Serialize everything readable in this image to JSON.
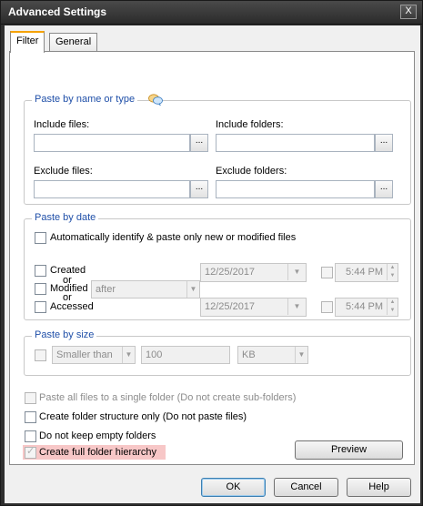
{
  "window": {
    "title": "Advanced Settings",
    "close_glyph": "X"
  },
  "tabs": [
    {
      "label": "Filter",
      "active": true
    },
    {
      "label": "General",
      "active": false
    }
  ],
  "paste_by_name": {
    "title": "Paste by name or type",
    "include_files_label": "Include files:",
    "include_folders_label": "Include folders:",
    "exclude_files_label": "Exclude files:",
    "exclude_folders_label": "Exclude folders:",
    "browse_label": "...",
    "include_files_value": "",
    "include_folders_value": "",
    "exclude_files_value": "",
    "exclude_folders_value": ""
  },
  "paste_by_date": {
    "title": "Paste by date",
    "auto_label": "Automatically identify & paste only new or modified files",
    "created_label": "Created",
    "or1": "or",
    "modified_label": "Modified",
    "or2": "or",
    "accessed_label": "Accessed",
    "condition": "after",
    "date1": "12/25/2017",
    "date2": "12/25/2017",
    "time1": "5:44 PM",
    "time2": "5:44 PM"
  },
  "paste_by_size": {
    "title": "Paste by size",
    "comparison": "Smaller than",
    "value": "100",
    "unit": "KB"
  },
  "options": {
    "single_folder": "Paste all files to a single folder (Do not create sub-folders)",
    "structure_only": "Create folder structure only (Do not paste files)",
    "no_empty": "Do not keep empty folders",
    "full_hierarchy": "Create full folder hierarchy"
  },
  "buttons": {
    "preview": "Preview",
    "ok": "OK",
    "cancel": "Cancel",
    "help": "Help"
  },
  "icons": {
    "chat": "chat-bubbles-icon",
    "calendar": "calendar-icon",
    "dropdown": "chevron-down-icon"
  },
  "colors": {
    "group_title": "#1f4fa8",
    "tab_accent": "#f5a200",
    "highlight": "#f7c7c7"
  }
}
